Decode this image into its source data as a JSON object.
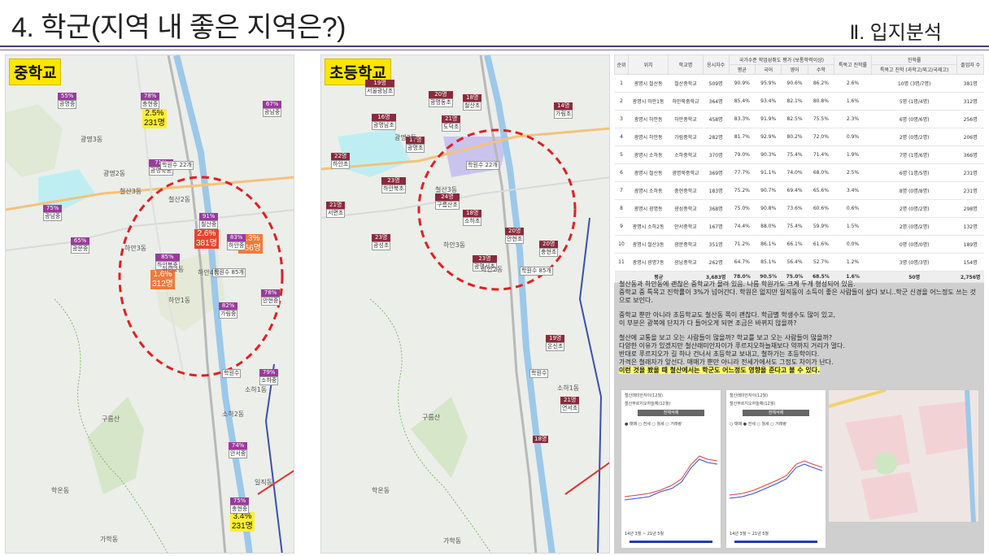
{
  "header": {
    "title": "4. 학군(지역 내 좋은 지역은?)",
    "section": "Ⅱ. 입지분석"
  },
  "maps": {
    "middle_school": {
      "tag": "중학교",
      "stats": [
        {
          "pct": "2.5%",
          "count": "231명"
        },
        {
          "pct": "2.6%",
          "count": "381명"
        },
        {
          "pct": "2.3%",
          "count": "256명"
        },
        {
          "pct": "1.6%",
          "count": "312명"
        },
        {
          "pct": "3.4%",
          "count": "231명"
        }
      ],
      "markers": [
        {
          "pct": "55%",
          "name": "광명중"
        },
        {
          "pct": "78%",
          "name": "충현중"
        },
        {
          "pct": "67%",
          "name": "광남중"
        },
        {
          "pct": "71%",
          "name": "광명북중"
        },
        {
          "pct": "75%",
          "name": "광남중"
        },
        {
          "pct": "65%",
          "name": "광문중"
        },
        {
          "pct": "85%",
          "name": "하안북중"
        },
        {
          "pct": "91%",
          "name": "철산중"
        },
        {
          "pct": "83%",
          "name": "하안중"
        },
        {
          "pct": "78%",
          "name": "안현중"
        },
        {
          "pct": "82%",
          "name": "가림중"
        },
        {
          "pct": "79%",
          "name": "소하중"
        },
        {
          "pct": "74%",
          "name": "안서중"
        },
        {
          "pct": "75%",
          "name": "충현중"
        }
      ],
      "dongs": [
        "광명3동",
        "광명2동",
        "철산3동",
        "철산2동",
        "하안3동",
        "하안1동",
        "하안2동",
        "하안4동",
        "소하1동",
        "소하2동",
        "학온동",
        "구름산",
        "가학동",
        "일직동"
      ],
      "academy_labels": [
        "학원수 22개",
        "학원수 85개",
        "학원수"
      ]
    },
    "elementary_school": {
      "tag": "초등학교",
      "counts": [
        "19명",
        "20명",
        "16명",
        "18명",
        "21명",
        "17명",
        "22명",
        "23명",
        "24명",
        "18명",
        "21명",
        "14명",
        "20명",
        "23명",
        "20명",
        "23명",
        "19명",
        "21명",
        "18명"
      ],
      "names": [
        "서울광남초",
        "광명동초",
        "광명남초",
        "철산초",
        "도덕초",
        "광명초",
        "하안초",
        "하안북초",
        "구름산초",
        "소하초",
        "서면초",
        "가림초",
        "안현초",
        "광성초",
        "충현초",
        "광명서초",
        "온신초",
        "연서초"
      ],
      "dongs": [
        "광명3동",
        "철산3동",
        "하안2동",
        "하안3동",
        "소하1동",
        "학온동",
        "구름산",
        "가학동"
      ],
      "academy_labels": [
        "학원수 22개",
        "학원수 85개",
        "학원수"
      ]
    }
  },
  "table": {
    "headers": [
      "순위",
      "위치",
      "학교명",
      "응시자수",
      "국가수준 학업성취도 평가 (보통학력이상)",
      "평균",
      "국어",
      "영어",
      "수학",
      "특목고 진학률",
      "진학률",
      "특목고 진학 (과학고/외고/국제고)",
      "졸업자 수"
    ],
    "rows": [
      [
        "1",
        "광명시 철산동",
        "철산중학교",
        "509명",
        "90.9%",
        "95.9%",
        "90.6%",
        "86.2%",
        "2.6%",
        "10명 (3명/7명)",
        "381명"
      ],
      [
        "2",
        "광명시 하안1동",
        "하안북중학교",
        "364명",
        "85.4%",
        "93.4%",
        "82.1%",
        "80.8%",
        "1.6%",
        "5명 (1명/4명)",
        "312명"
      ],
      [
        "3",
        "광명시 하안동",
        "하안중학교",
        "458명",
        "83.3%",
        "91.9%",
        "82.5%",
        "75.5%",
        "2.3%",
        "6명 (0명/6명)",
        "256명"
      ],
      [
        "4",
        "광명시 하안동",
        "가림중학교",
        "282명",
        "81.7%",
        "92.9%",
        "80.2%",
        "72.0%",
        "0.9%",
        "2명 (0명/2명)",
        "206명"
      ],
      [
        "5",
        "광명시 소하동",
        "소하중학교",
        "370명",
        "79.0%",
        "90.3%",
        "75.4%",
        "71.4%",
        "1.9%",
        "7명 (1명/6명)",
        "366명"
      ],
      [
        "6",
        "광명시 철산동",
        "광명북중학교",
        "369명",
        "77.7%",
        "91.1%",
        "74.0%",
        "68.0%",
        "2.5%",
        "6명 (1명/5명)",
        "231명"
      ],
      [
        "7",
        "광명시 소하동",
        "충현중학교",
        "183명",
        "75.2%",
        "90.7%",
        "69.4%",
        "65.6%",
        "3.4%",
        "8명 (0명/8명)",
        "231명"
      ],
      [
        "8",
        "광명시 광명동",
        "광성중학교",
        "368명",
        "75.0%",
        "90.8%",
        "73.6%",
        "60.6%",
        "0.6%",
        "2명 (0명/2명)",
        "298명"
      ],
      [
        "9",
        "광명시 소하2동",
        "안서중학교",
        "167명",
        "74.4%",
        "88.0%",
        "75.4%",
        "59.9%",
        "1.5%",
        "2명 (0명/2명)",
        "132명"
      ],
      [
        "10",
        "광명시 철산3동",
        "광문중학교",
        "351명",
        "71.2%",
        "86.1%",
        "66.1%",
        "61.6%",
        "0.0%",
        "0명 (0명/0명)",
        "189명"
      ],
      [
        "11",
        "광명시 광명7동",
        "광남중학교",
        "262명",
        "64.7%",
        "85.1%",
        "56.4%",
        "52.7%",
        "1.2%",
        "3명 (0명/3명)",
        "154명"
      ]
    ],
    "average": [
      "평균",
      "3,683명",
      "78.0%",
      "90.5%",
      "75.0%",
      "68.5%",
      "1.6%",
      "50명",
      "2,756명"
    ]
  },
  "description": [
    "철산동과 하안동에 괜찮은 중학교가 몰려 있음. 나름 학원가도 크게 두개 형성되어 있음.",
    "중학교 중 특목고 진학률이 3%가 넘어간다. 학원은 없지만 일직동이 소득이 좋은 사람들이 살다 보니..학군 신경을 어느정도 쓰는 것으로 보인다.",
    "중학교 뿐만 아니라 초등학교도 철산동 쪽이 괜찮다. 학급별 학생수도 많이 있고,",
    "이 부분은 광복에 단지가 다 들어오게 되면 조금은 바뀌지 않을까?",
    "철산에 교통을 보고 오는 사람들이 많을까? 학교를 보고 오는 사람들이 많을까?",
    "다양한 이유가 있겠지만 철산래미안자이가 푸르지오하늘채보다 약까지 거리가 멀다.",
    "반대로 푸르지오가 길 하나 건너서 초등학교 보내고, 철하가는 초등학이다.",
    "가격은 철래자가 앞선다. 매매가 뿐만 아니라 전세가에서도 그정도 차이가 난다.",
    "이런 것을 봤을 때 철산에서는 학군도 어느정도 영향을 준다고 볼 수 있다."
  ],
  "charts": [
    {
      "legend": [
        "철산래미안자이(12월)",
        "철산푸르지오하늘채(12월)"
      ],
      "button": "전체삭제",
      "tabs": [
        "매매",
        "전세",
        "월세",
        "거래량"
      ],
      "range": "14년 3월 ~ 21년 5월"
    },
    {
      "legend": [
        "철산래미안자이(12월)",
        "철산푸르지오하늘채(12월)"
      ],
      "button": "전체삭제",
      "tabs": [
        "매매",
        "전세",
        "월세",
        "거래량"
      ],
      "range": "14년 3월 ~ 21년 5월"
    }
  ]
}
